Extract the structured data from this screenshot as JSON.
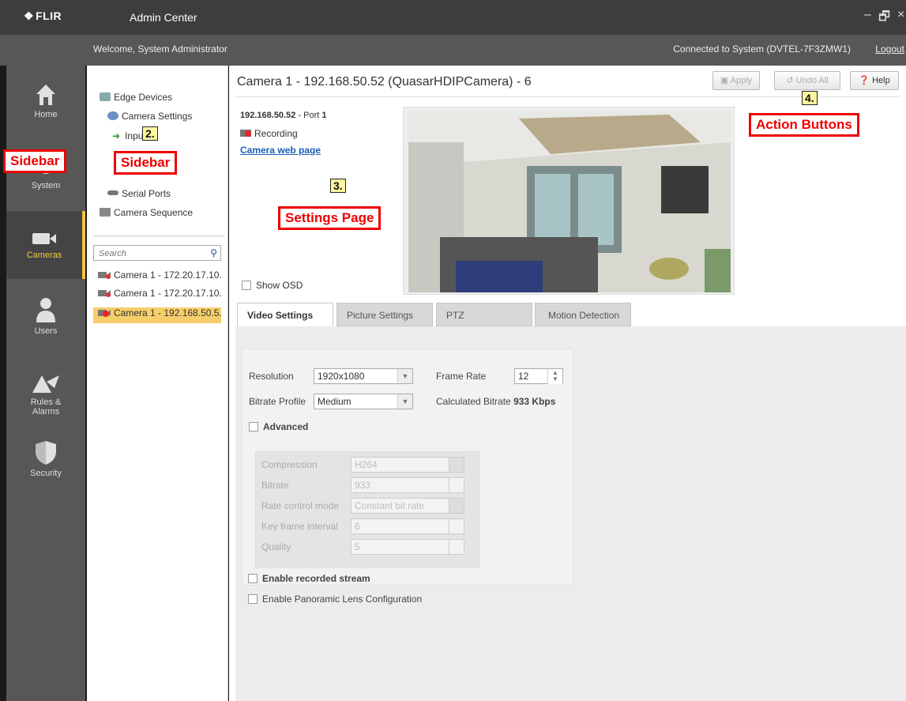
{
  "titlebar": {
    "logo": "FLIR",
    "app_title": "Admin Center",
    "minimize": "–",
    "maximize": "🗗",
    "close": "×"
  },
  "welcome": {
    "greeting": "Welcome, System Administrator",
    "connection": "Connected to System (DVTEL-7F3ZMW1)",
    "logout": "Logout"
  },
  "nav": {
    "items": [
      {
        "label": "Home",
        "icon": "home-icon"
      },
      {
        "label": "System",
        "icon": "gear-icon"
      },
      {
        "label": "Cameras",
        "icon": "camera-icon",
        "active": true
      },
      {
        "label": "Users",
        "icon": "user-icon"
      },
      {
        "label": "Rules & Alarms",
        "label_line1": "Rules &",
        "label_line2": "Alarms",
        "icon": "alarm-icon"
      },
      {
        "label": "Security",
        "icon": "shield-icon"
      }
    ]
  },
  "tree": {
    "items": [
      "Edge Devices",
      "Camera Settings",
      "Inpu",
      "Serial Ports",
      "Camera Sequence"
    ]
  },
  "search": {
    "placeholder": "Search"
  },
  "cameras": [
    {
      "label": "Camera 1 - 172.20.17.10..",
      "recording": false
    },
    {
      "label": "Camera 1 - 172.20.17.10..",
      "recording": false
    },
    {
      "label": "Camera 1 - 192.168.50.5..",
      "recording": true,
      "selected": true
    }
  ],
  "main": {
    "page_title": "Camera 1 - 192.168.50.52 (QuasarHDIPCamera) - 6",
    "buttons": {
      "apply": "Apply",
      "undo_all": "Undo All",
      "help": "Help"
    },
    "cam_ip": "192.168.50.52",
    "port_label": " - Port ",
    "port_value": "1",
    "recording": "Recording",
    "web_page": "Camera web page",
    "show_osd": "Show OSD",
    "tabs": [
      "Video Settings",
      "Picture Settings",
      "PTZ",
      "Motion Detection"
    ]
  },
  "settings": {
    "resolution_label": "Resolution",
    "resolution_value": "1920x1080",
    "frame_rate_label": "Frame Rate",
    "frame_rate_value": "12",
    "bitrate_profile_label": "Bitrate Profile",
    "bitrate_profile_value": "Medium",
    "calc_bitrate_label": "Calculated Bitrate",
    "calc_bitrate_value": "933 Kbps",
    "advanced_label": "Advanced",
    "compression_label": "Compression",
    "compression_value": "H264",
    "bitrate_label": "Bitrate",
    "bitrate_value": "933",
    "rate_control_label": "Rate control mode",
    "rate_control_value": "Constant bit rate",
    "key_frame_label": "Key frame interval",
    "key_frame_value": "6",
    "quality_label": "Quality",
    "quality_value": "5",
    "recorded_stream_label": "Enable recorded stream",
    "panoramic_label": "Enable Panoramic Lens Configuration"
  },
  "annotations": {
    "sidebar_nav": "Sidebar",
    "sidebar_tree": "Sidebar",
    "badge_2": "2.",
    "settings_page": "Settings Page",
    "badge_3": "3.",
    "action_buttons": "Action Buttons",
    "badge_4": "4."
  },
  "colors": {
    "accent": "#f5c542",
    "annotation": "#e00000",
    "link": "#1a5fb4"
  }
}
